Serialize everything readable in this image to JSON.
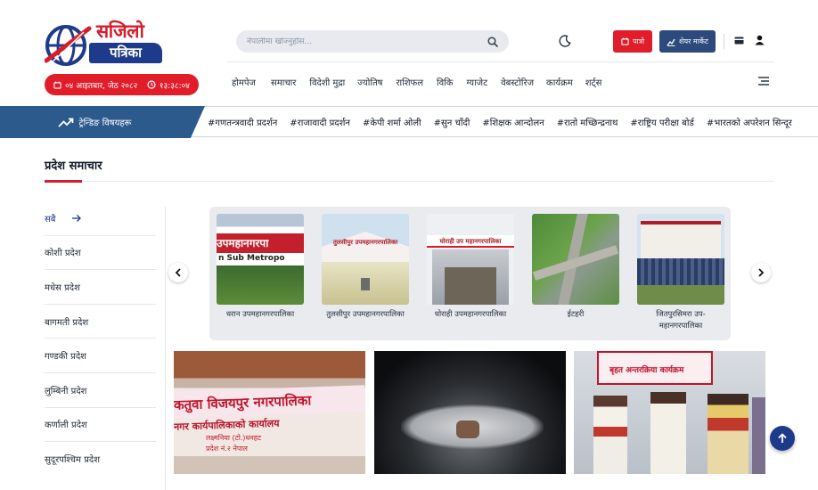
{
  "brand": {
    "line1": "सजिलो",
    "line2": "पत्रिका"
  },
  "header": {
    "date": "०४ आइतबार, जेठ २०८२",
    "time": "१३:३८:०४",
    "search_placeholder": "नेपालीमा खोज्नुहोस...",
    "btn_rashifal": "पात्रो",
    "btn_share": "शेयर मार्केट",
    "icons": [
      "moon-icon",
      "calendar-icon",
      "chart-icon",
      "card-icon",
      "user-icon"
    ]
  },
  "nav": {
    "items": [
      "होमपेज",
      "समाचार",
      "विदेशी मुद्रा",
      "ज्योतिष",
      "राशिफल",
      "विकि",
      "ग्याजेट",
      "वेबस्टोरिज",
      "कार्यक्रम",
      "शर्ट्स"
    ]
  },
  "trending": {
    "label": "ट्रेन्डिङ विषयहरू",
    "tags": [
      "#गणतन्त्रवादी प्रदर्शन",
      "#राजावादी प्रदर्शन",
      "#केपी शर्मा ओली",
      "#सुन चाँदी",
      "#शिक्षक आन्दोलन",
      "#रातो मच्छिन्द्रनाथ",
      "#राष्ट्रिय परीक्षा बोर्ड",
      "#भारतको अपरेशन सिन्दूर"
    ]
  },
  "section": {
    "title": "प्रदेश समाचार",
    "provinces": [
      "सबै",
      "कोशी प्रदेश",
      "मधेस प्रदेश",
      "बागमती प्रदेश",
      "गण्डकी प्रदेश",
      "लुम्बिनी प्रदेश",
      "कर्णाली प्रदेश",
      "सुदूरपश्चिम प्रदेश"
    ]
  },
  "carousel": {
    "items": [
      {
        "caption": "धरान उपमहानगरपालिका",
        "sign": "उपमहानगरपा",
        "sign2": "n Sub Metropo"
      },
      {
        "caption": "तुलसीपुर उपमहानगरपालिका",
        "sign": "तुलसीपुर उपमहानगरपालिका"
      },
      {
        "caption": "धोराही उपमहानगरपालिका",
        "sign": "घोराही उप महानगरपालिका"
      },
      {
        "caption": "ईटहरी"
      },
      {
        "caption": "जितपुरसिमरा उप-महानगरपालिका"
      }
    ]
  },
  "news": {
    "items": [
      {
        "sign1": "कतुवा विजयपुर नगरपालिका",
        "sign2": "नगर कार्यपालिकाको कार्यालय",
        "sign3": "लक्ष्मनिया (टो.)धनहट",
        "sign4": "प्रदेश नं.२ नेपाल"
      },
      {
        "alt": "dead-body-photo"
      },
      {
        "banner": "बृहत अन्तरक्रिया कार्यक्रम"
      }
    ]
  }
}
